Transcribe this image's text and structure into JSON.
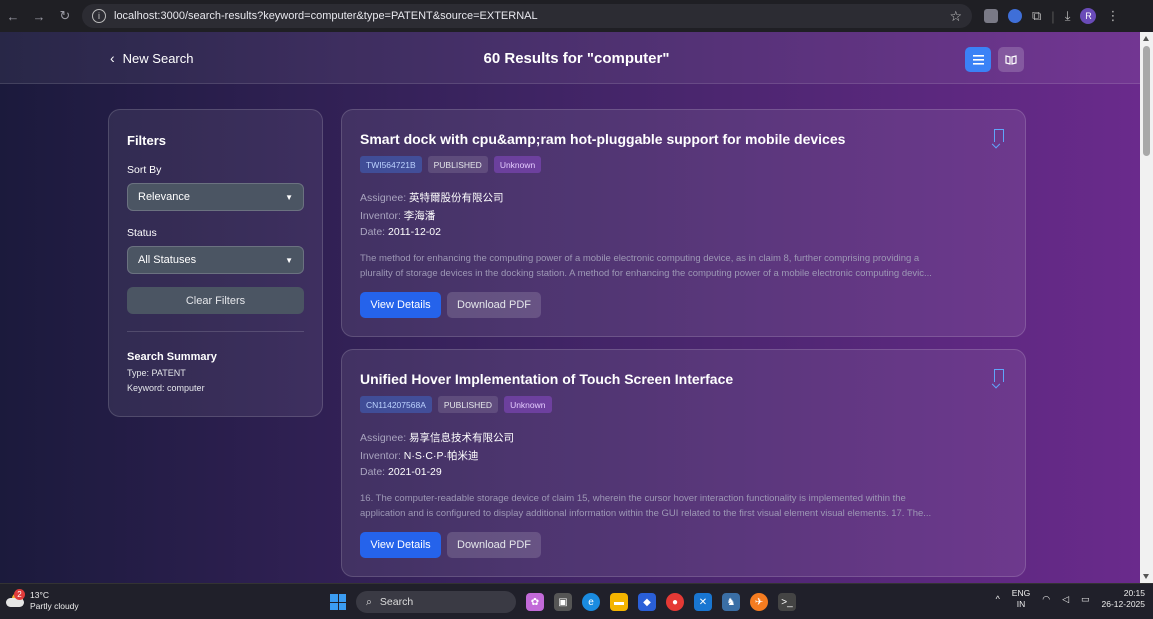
{
  "browser": {
    "url": "localhost:3000/search-results?keyword=computer&type=PATENT&source=EXTERNAL",
    "profile_initial": "R"
  },
  "header": {
    "back_label": "New Search",
    "results_title": "60 Results for \"computer\""
  },
  "filters": {
    "title": "Filters",
    "sort_label": "Sort By",
    "sort_value": "Relevance",
    "status_label": "Status",
    "status_value": "All Statuses",
    "clear_label": "Clear Filters",
    "summary_title": "Search Summary",
    "summary_type_label": "Type:",
    "summary_type_value": "PATENT",
    "summary_keyword_label": "Keyword:",
    "summary_keyword_value": "computer"
  },
  "results": [
    {
      "title": "Smart dock with cpu&amp;ram hot-pluggable support for mobile devices",
      "id": "TWI564721B",
      "status": "PUBLISHED",
      "type": "Unknown",
      "assignee_label": "Assignee:",
      "assignee": "英特爾股份有限公司",
      "inventor_label": "Inventor:",
      "inventor": "李海潘",
      "date_label": "Date:",
      "date": "2011-12-02",
      "abstract_line1": "The method for enhancing the computing power of a mobile electronic computing device, as in claim 8, further comprising providing a",
      "abstract_line2": "plurality of storage devices in the docking station. A method for enhancing the computing power of a mobile electronic computing devic...",
      "view_label": "View Details",
      "pdf_label": "Download PDF"
    },
    {
      "title": "Unified Hover Implementation of Touch Screen Interface",
      "id": "CN114207568A",
      "status": "PUBLISHED",
      "type": "Unknown",
      "assignee_label": "Assignee:",
      "assignee": "易享信息技术有限公司",
      "inventor_label": "Inventor:",
      "inventor": "N·S·C·P·帕米迪",
      "date_label": "Date:",
      "date": "2021-01-29",
      "abstract_line1": "16. The computer-readable storage device of claim 15, wherein the cursor hover interaction functionality is implemented within the",
      "abstract_line2": "application and is configured to display additional information within the GUI related to the first visual element visual elements. 17. The...",
      "view_label": "View Details",
      "pdf_label": "Download PDF"
    }
  ],
  "taskbar": {
    "weather_temp": "13°C",
    "weather_desc": "Partly cloudy",
    "weather_badge": "2",
    "search_label": "Search",
    "lang_top": "ENG",
    "lang_bottom": "IN",
    "time": "20:15",
    "date": "26-12-2025"
  },
  "colors": {
    "accent": "#2563eb",
    "page_gradient_start": "#1b1a3c",
    "page_gradient_end": "#6a2a8c"
  }
}
